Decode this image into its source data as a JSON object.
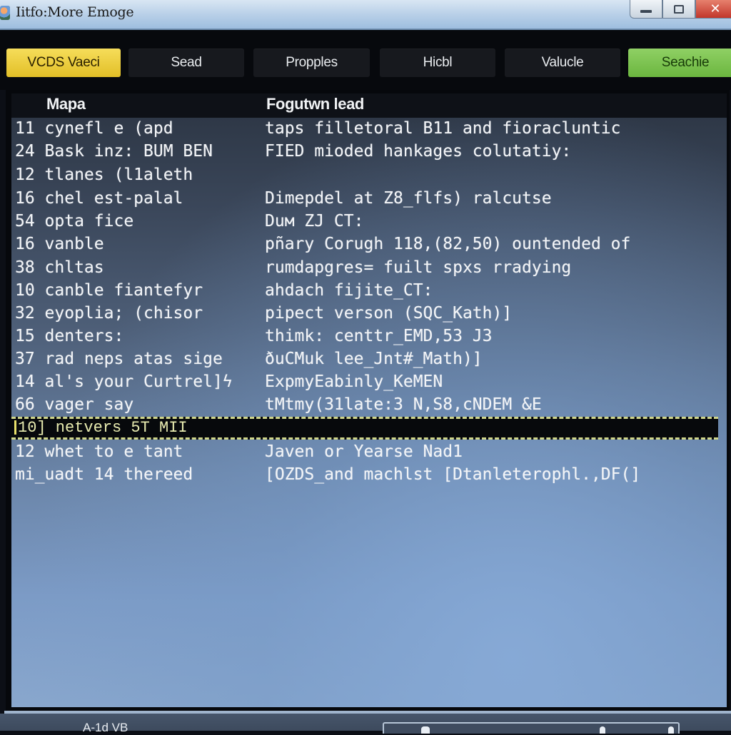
{
  "window": {
    "title": "Iitfo:More Emoge",
    "controls": {
      "minimize": "minimize",
      "maximize": "maximize",
      "close": "✕"
    }
  },
  "toolbar": {
    "buttons": [
      {
        "label": "VCDS Vaeci",
        "style": "yellow"
      },
      {
        "label": "Sead",
        "style": "dark"
      },
      {
        "label": "Propples",
        "style": "dark"
      },
      {
        "label": "Hicbl",
        "style": "dark"
      },
      {
        "label": "Valucle",
        "style": "dark"
      },
      {
        "label": "Seachie",
        "style": "green"
      }
    ]
  },
  "table": {
    "headers": [
      "Mapa",
      "Fogutwn lead"
    ],
    "rows": [
      {
        "left": "11 cynefl e (apd",
        "right": "taps filletoral B11 and fioracluntic"
      },
      {
        "left": "24 Bask inz: BUM BEN",
        "right": "FIED mioded hankages colutatiy:"
      },
      {
        "left": "12 tlanes (l1aleth",
        "right": ""
      },
      {
        "left": "16 chel est-palal",
        "right": "Dimepdel at Z8_flfs) ralcutse"
      },
      {
        "left": "54 opta fice",
        "right": "Duм ZJ CT:"
      },
      {
        "left": "16 vanble",
        "right": "pñary Corugh 118,(82,50) ountended of"
      },
      {
        "left": "38 chltas",
        "right": "rumdapgres= fuilt spxs rradying"
      },
      {
        "left": "10 canble fiantefyr",
        "right": "ahdach fijite_CT:"
      },
      {
        "left": "32 eyoplia; (chisor",
        "right": "pipect verson (SQC_Kath)]"
      },
      {
        "left": "15 denters:",
        "right": "thimk: centtr_EMD,53 J3"
      },
      {
        "left": "37 rad neps atas sige",
        "right": "ðuCMuk lee_Jnt#_Math)]"
      },
      {
        "left": "14 al's your Curtrel]ϟ",
        "right": "ExpmyEabinly_KeMEN"
      },
      {
        "left": "66 vager say",
        "right": "tMtmy(31late:3 N,S8,cNDEM &E"
      }
    ],
    "selected_row": {
      "text": "10] netvers 5T MII"
    },
    "rows_after": [
      {
        "left": "12 whet to e tant",
        "right": "Javen or Yearse Nad1"
      },
      {
        "left": "mi_uadt 14 thereed",
        "right": "[OZDS_and machlst [Dtanleterophl.,DF(]"
      }
    ]
  },
  "statusbar": {
    "text": "A-1d VB"
  },
  "colors": {
    "accent_yellow": "#f0d344",
    "accent_green": "#7cc34f",
    "selection_border": "#cfd58a",
    "close_red": "#d0483a"
  }
}
